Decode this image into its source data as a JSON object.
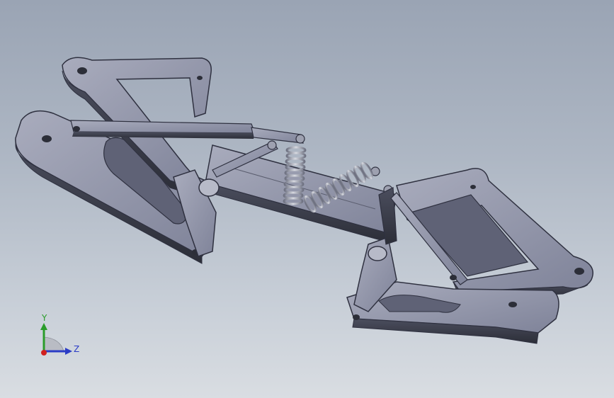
{
  "viewport": {
    "background_top": "#9aa4b4",
    "background_bottom": "#d9dde2"
  },
  "model": {
    "part_color": "#7d8196",
    "part_dark": "#3a3d4a",
    "part_light": "#c9ccd8",
    "spring_color": "#9da0ad"
  },
  "triad": {
    "y_label": "Y",
    "z_label": "Z",
    "y_color": "#2a9c2a",
    "z_color": "#2b3cc6",
    "x_color": "#d02020"
  }
}
